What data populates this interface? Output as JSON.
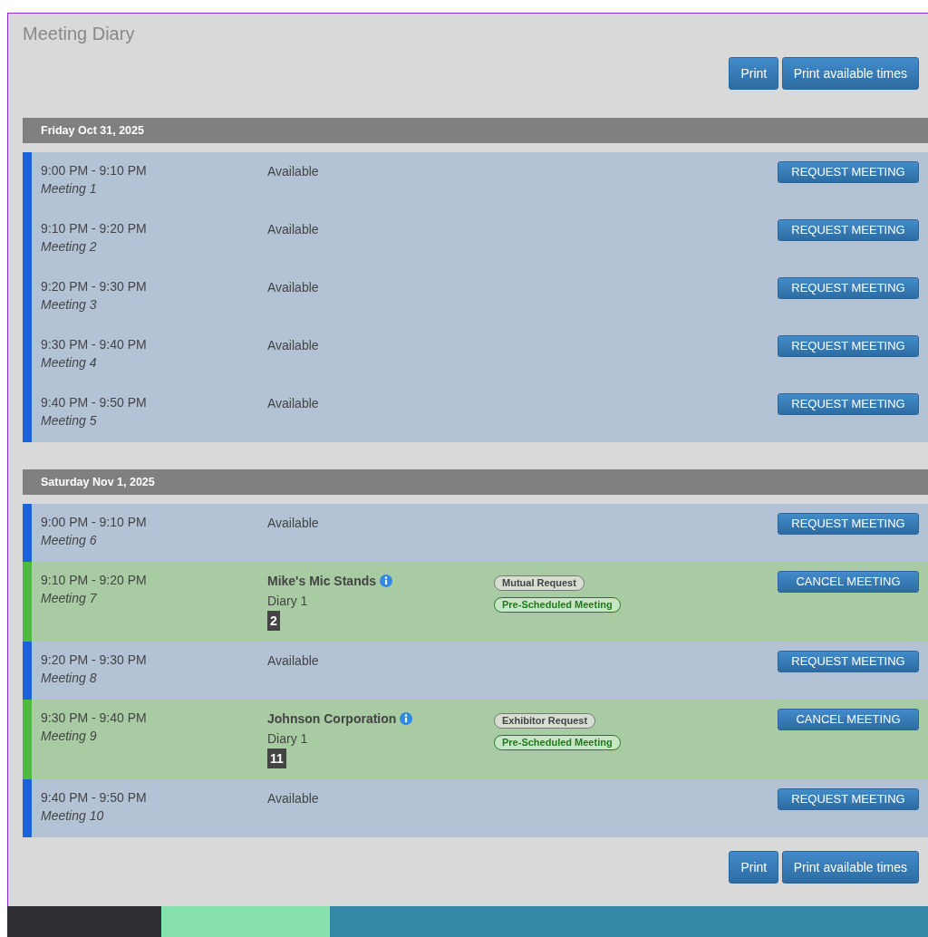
{
  "title": "Meeting Diary",
  "top_buttons": [
    "Print",
    "Print available times"
  ],
  "days": [
    {
      "date": "Friday Oct 31, 2025",
      "slots": [
        {
          "kind": "available",
          "time": "9:00 PM - 9:10 PM",
          "meeting": "Meeting 1",
          "status": "Available",
          "button": "REQUEST MEETING"
        },
        {
          "kind": "available",
          "time": "9:10 PM - 9:20 PM",
          "meeting": "Meeting 2",
          "status": "Available",
          "button": "REQUEST MEETING"
        },
        {
          "kind": "available",
          "time": "9:20 PM - 9:30 PM",
          "meeting": "Meeting 3",
          "status": "Available",
          "button": "REQUEST MEETING"
        },
        {
          "kind": "available",
          "time": "9:30 PM - 9:40 PM",
          "meeting": "Meeting 4",
          "status": "Available",
          "button": "REQUEST MEETING"
        },
        {
          "kind": "available",
          "time": "9:40 PM - 9:50 PM",
          "meeting": "Meeting 5",
          "status": "Available",
          "button": "REQUEST MEETING"
        }
      ]
    },
    {
      "date": "Saturday Nov 1, 2025",
      "slots": [
        {
          "kind": "available",
          "time": "9:00 PM - 9:10 PM",
          "meeting": "Meeting 6",
          "status": "Available",
          "button": "REQUEST MEETING"
        },
        {
          "kind": "booked",
          "time": "9:10 PM - 9:20 PM",
          "meeting": "Meeting 7",
          "company": "Mike's Mic Stands",
          "diary": "Diary 1",
          "number": "2",
          "tags": [
            {
              "kind": "request",
              "label": "Mutual Request"
            },
            {
              "kind": "scheduled",
              "label": "Pre-Scheduled Meeting"
            }
          ],
          "button": "CANCEL MEETING"
        },
        {
          "kind": "available",
          "time": "9:20 PM - 9:30 PM",
          "meeting": "Meeting 8",
          "status": "Available",
          "button": "REQUEST MEETING"
        },
        {
          "kind": "booked",
          "time": "9:30 PM - 9:40 PM",
          "meeting": "Meeting 9",
          "company": "Johnson Corporation",
          "diary": "Diary 1",
          "number": "11",
          "tags": [
            {
              "kind": "request",
              "label": "Exhibitor Request"
            },
            {
              "kind": "scheduled",
              "label": "Pre-Scheduled Meeting"
            }
          ],
          "button": "CANCEL MEETING"
        },
        {
          "kind": "available",
          "time": "9:40 PM - 9:50 PM",
          "meeting": "Meeting 10",
          "status": "Available",
          "button": "REQUEST MEETING"
        }
      ]
    }
  ],
  "bottom_buttons": [
    "Print",
    "Print available times"
  ]
}
